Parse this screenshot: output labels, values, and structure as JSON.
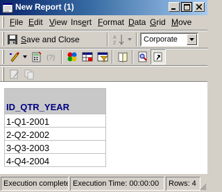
{
  "window": {
    "title": "New Report (1)"
  },
  "menu": [
    {
      "label": "File",
      "u": "F",
      "rest": "ile"
    },
    {
      "label": "Edit",
      "u": "E",
      "rest": "dit"
    },
    {
      "label": "View",
      "u": "V",
      "rest": "iew"
    },
    {
      "label": "Insert",
      "pre": "Ins",
      "u": "e",
      "rest": "rt"
    },
    {
      "label": "Format",
      "u": "F",
      "rest": "ormat"
    },
    {
      "label": "Data",
      "u": "D",
      "rest": "ata"
    },
    {
      "label": "Grid",
      "u": "G",
      "rest": "rid"
    },
    {
      "label": "Move",
      "u": "M",
      "rest": "ove"
    }
  ],
  "toolbar": {
    "save_close": {
      "u": "S",
      "rest": "ave and Close"
    },
    "style_combo": {
      "value": "Corporate"
    }
  },
  "grid": {
    "header": "ID_QTR_YEAR",
    "rows": [
      "1-Q1-2001",
      "2-Q2-2002",
      "3-Q3-2003",
      "4-Q4-2004"
    ]
  },
  "status": {
    "state": "Execution complete",
    "time": "Execution Time: 00:00:00",
    "rows": "Rows: 4"
  }
}
